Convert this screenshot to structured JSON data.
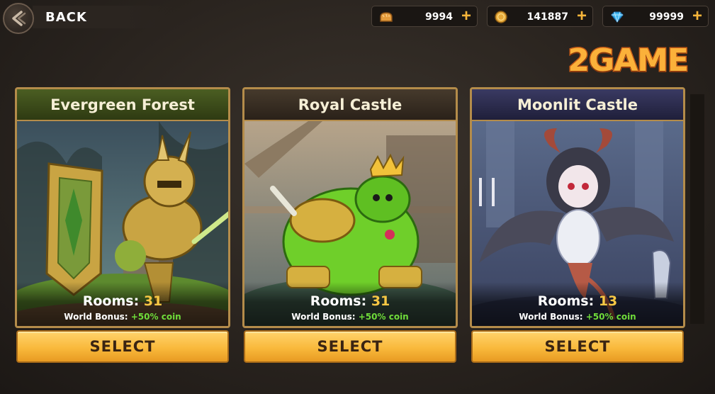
{
  "header": {
    "back_label": "BACK",
    "resources": [
      {
        "icon": "bread-icon",
        "value": "9994"
      },
      {
        "icon": "coin-icon",
        "value": "141887"
      },
      {
        "icon": "diamond-icon",
        "value": "99999"
      }
    ],
    "plus": "+"
  },
  "logo": "2GAME",
  "worlds": [
    {
      "name": "Evergreen Forest",
      "rooms_label": "Rooms:",
      "rooms": "31",
      "bonus_label": "World Bonus:",
      "bonus_value": "+50% coin",
      "select_label": "SELECT",
      "accent": "#3a4a1c"
    },
    {
      "name": "Royal Castle",
      "rooms_label": "Rooms:",
      "rooms": "31",
      "bonus_label": "World Bonus:",
      "bonus_value": "+50% coin",
      "select_label": "SELECT",
      "accent": "#3a2e22"
    },
    {
      "name": "Moonlit Castle",
      "rooms_label": "Rooms:",
      "rooms": "13",
      "bonus_label": "World Bonus:",
      "bonus_value": "+50% coin",
      "select_label": "SELECT",
      "accent": "#2a2a48"
    }
  ],
  "colors": {
    "select_button": "#f9b93c",
    "card_border": "#b48c4a",
    "rooms_number": "#f7c744",
    "bonus_value": "#6fdc3a",
    "plus": "#f7b53a"
  }
}
